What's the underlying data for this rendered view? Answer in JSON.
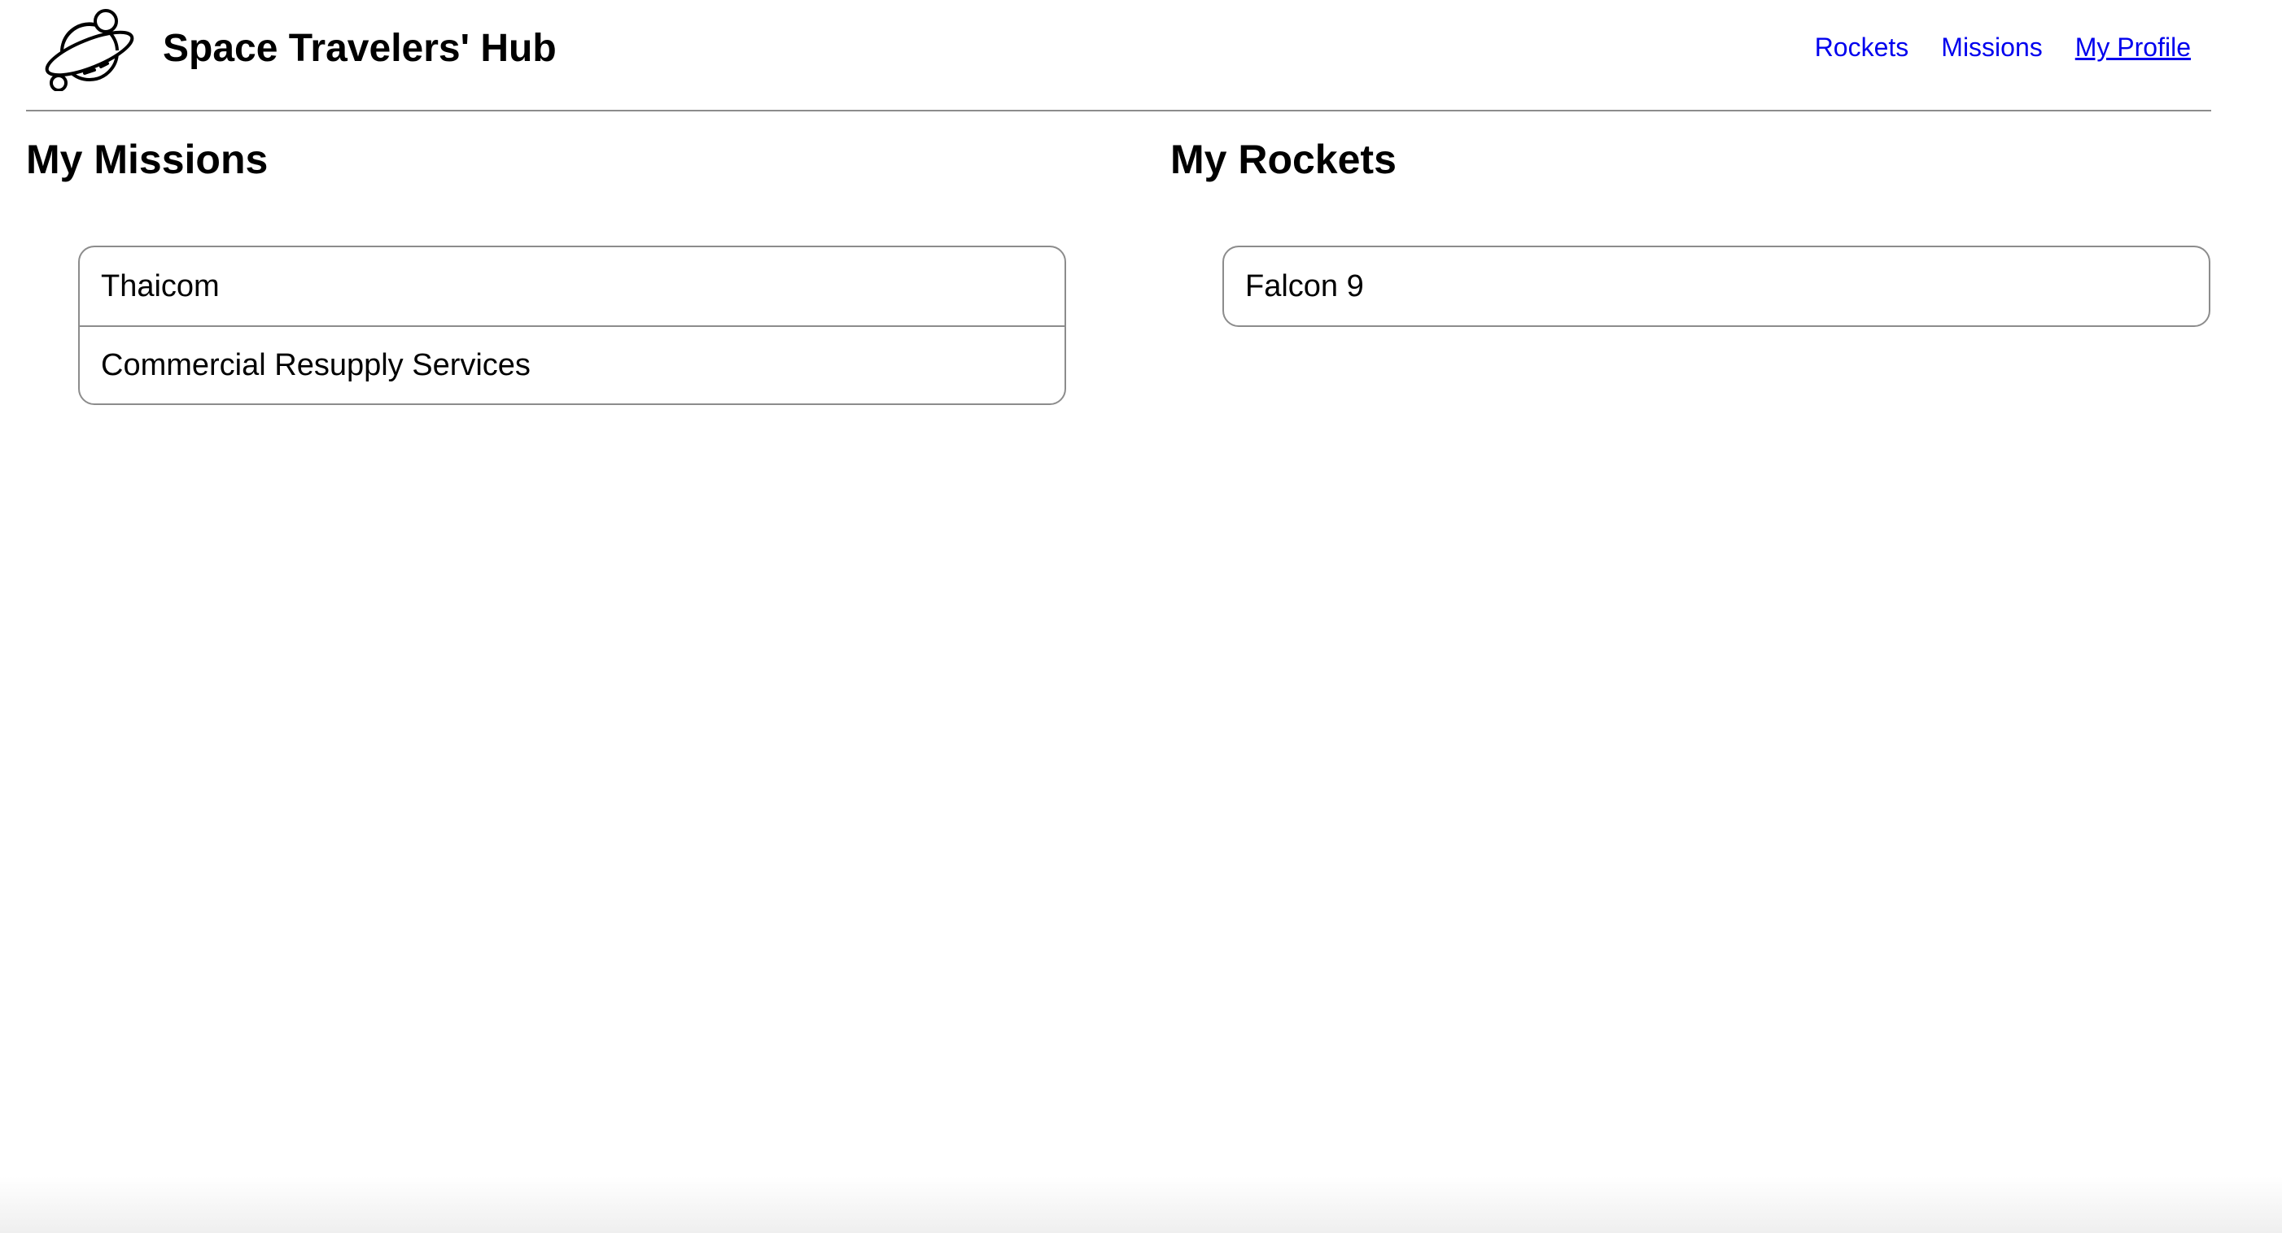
{
  "header": {
    "brand_title": "Space Travelers' Hub",
    "logo_icon": "planet-logo-icon",
    "nav": [
      {
        "label": "Rockets",
        "active": false
      },
      {
        "label": "Missions",
        "active": false
      },
      {
        "label": "My Profile",
        "active": true
      }
    ]
  },
  "missions": {
    "title": "My Missions",
    "items": [
      "Thaicom",
      "Commercial Resupply Services"
    ]
  },
  "rockets": {
    "title": "My Rockets",
    "items": [
      "Falcon 9"
    ]
  },
  "colors": {
    "link": "#0000ee",
    "border": "#8c8c8c",
    "text": "#000000",
    "background": "#ffffff"
  }
}
